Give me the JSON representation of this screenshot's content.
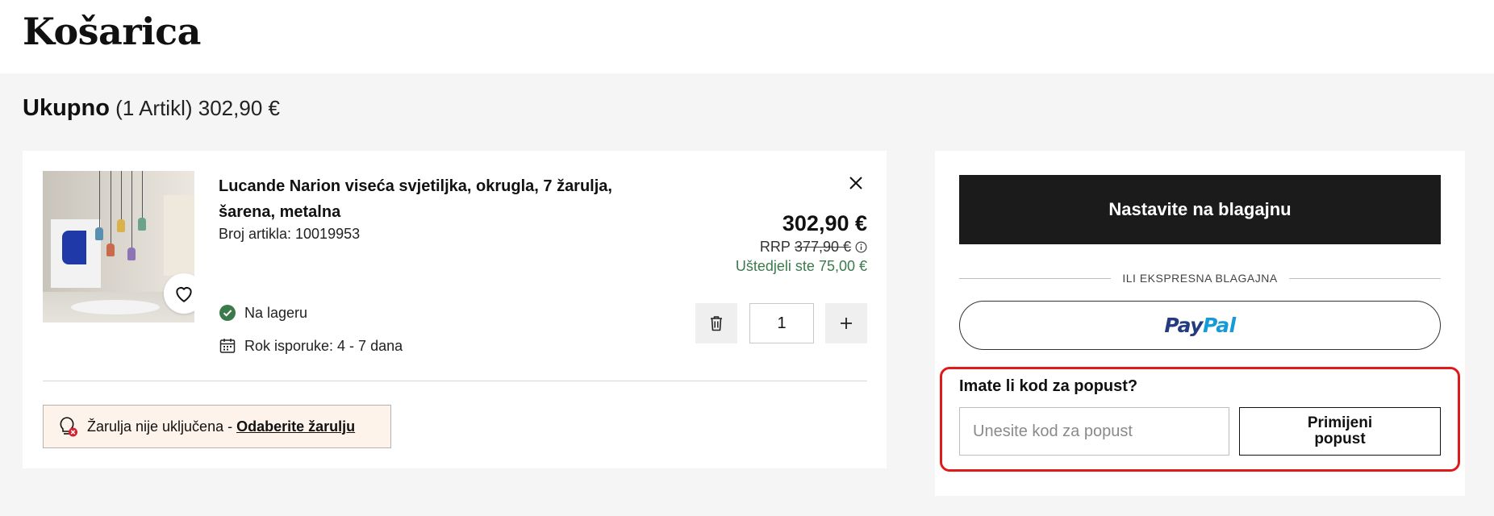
{
  "page": {
    "title": "Košarica"
  },
  "totals": {
    "label": "Ukupno",
    "count": "(1 Artikl)",
    "amount": "302,90 €"
  },
  "cart": {
    "item": {
      "name": "Lucande Narion viseća svjetiljka, okrugla, 7 žarulja, šarena, metalna",
      "sku": "Broj artikla: 10019953",
      "price": "302,90 €",
      "rrp_label": "RRP",
      "rrp_old": "377,90 €",
      "saved": "Uštedjeli ste 75,00 €",
      "stock": "Na lageru",
      "delivery": "Rok isporuke: 4 - 7 dana",
      "quantity": "1"
    },
    "bulb_note": {
      "text": "Žarulja nije uključena - ",
      "link": "Odaberite žarulju"
    }
  },
  "summary": {
    "checkout_label": "Nastavite na blagajnu",
    "express_label": "ILI EKSPRESNA BLAGAJNA",
    "paypal": {
      "part1": "Pay",
      "part2": "Pal"
    },
    "promo": {
      "title": "Imate li kod za popust?",
      "placeholder": "Unesite kod za popust",
      "button": "Primijeni popust"
    }
  },
  "colors": {
    "accent_green": "#3c7a4b",
    "highlight_red": "#e01919",
    "checkout_bg": "#1b1b1b",
    "paypal_dark": "#253b80",
    "paypal_light": "#179bd7"
  }
}
